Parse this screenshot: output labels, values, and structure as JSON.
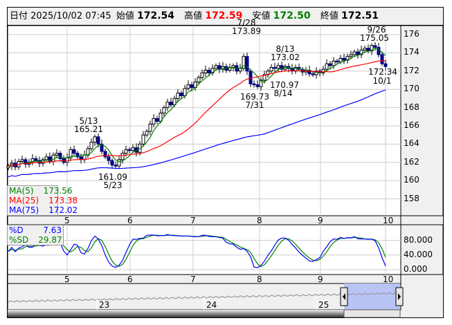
{
  "header": {
    "date_label": "日付",
    "datetime": "2025/10/02 07:45",
    "open_label": "始値",
    "open": "172.54",
    "high_label": "高値",
    "high": "172.59",
    "low_label": "安値",
    "low": "172.50",
    "close_label": "終値",
    "close": "172.51"
  },
  "colors": {
    "up_fill": "#ffffff",
    "down_fill": "#00008b",
    "ma5": "#008000",
    "ma25": "#ff0000",
    "ma75": "#0000ff",
    "high_text": "#ff0000",
    "low_text": "#008000"
  },
  "ma_legend": [
    {
      "label": "MA(5)",
      "value": "173.56"
    },
    {
      "label": "MA(25)",
      "value": "173.38"
    },
    {
      "label": "MA(75)",
      "value": "172.02"
    }
  ],
  "stoch_legend": [
    {
      "label": "%D",
      "value": "7.63"
    },
    {
      "label": "%SD",
      "value": "29.87"
    }
  ],
  "annotations": [
    {
      "date": "7/28",
      "price": "173.89"
    },
    {
      "date": "8/13",
      "price": "173.02"
    },
    {
      "date": "9/26",
      "price": "175.05"
    },
    {
      "date": "5/13",
      "price": "165.21"
    },
    {
      "date": "5/23",
      "price": "161.09"
    },
    {
      "date": "7/31",
      "price": "169.73"
    },
    {
      "date": "8/14",
      "price": "170.97"
    },
    {
      "date": "10/1",
      "price": "172.34"
    }
  ],
  "navigator": {
    "labels": [
      "23",
      "24",
      "25"
    ]
  },
  "chart_data": {
    "type": "candlestick",
    "price_axis": {
      "ticks": [
        "176",
        "174",
        "172",
        "170",
        "168",
        "166",
        "164",
        "162",
        "160",
        "158"
      ],
      "ylim": [
        157,
        177
      ]
    },
    "stoch_axis": {
      "ticks": [
        "80.000",
        "40.000",
        "0.000"
      ],
      "ylim": [
        0,
        100
      ]
    },
    "month_ticks": [
      "5",
      "6",
      "7",
      "8",
      "9",
      "10"
    ],
    "closes": [
      161.6,
      161.9,
      161.5,
      162.1,
      162.3,
      161.8,
      162.0,
      162.4,
      162.2,
      161.9,
      162.3,
      162.6,
      162.1,
      162.8,
      163.0,
      162.4,
      162.0,
      162.5,
      163.4,
      163.0,
      162.6,
      162.3,
      162.8,
      163.5,
      164.2,
      164.8,
      164.0,
      163.2,
      162.6,
      162.2,
      161.7,
      161.6,
      162.3,
      163.0,
      163.4,
      163.3,
      163.6,
      163.1,
      164.0,
      165.0,
      165.4,
      166.2,
      166.8,
      166.5,
      167.4,
      168.0,
      168.6,
      168.3,
      169.0,
      169.6,
      169.3,
      170.1,
      170.5,
      170.2,
      170.8,
      171.3,
      171.8,
      172.1,
      171.8,
      172.3,
      172.6,
      172.2,
      172.5,
      172.1,
      172.4,
      172.6,
      172.0,
      172.3,
      173.6,
      172.0,
      170.6,
      170.5,
      170.3,
      171.0,
      171.6,
      172.0,
      172.4,
      172.3,
      172.6,
      172.2,
      172.5,
      172.3,
      172.0,
      172.4,
      172.2,
      171.9,
      172.1,
      171.7,
      171.6,
      172.0,
      171.8,
      172.2,
      172.8,
      172.6,
      173.1,
      173.0,
      173.4,
      173.2,
      173.6,
      173.8,
      174.1,
      173.8,
      174.3,
      174.5,
      174.2,
      174.8,
      174.6,
      173.8,
      172.8,
      172.5
    ]
  }
}
